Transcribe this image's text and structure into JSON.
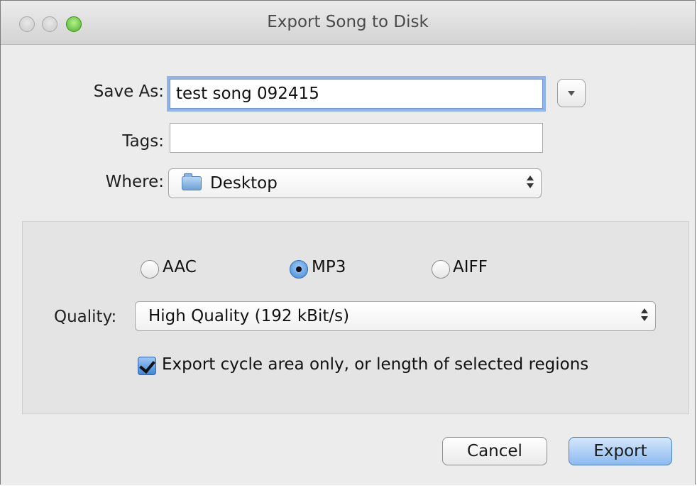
{
  "window": {
    "title": "Export Song to Disk"
  },
  "form": {
    "save_as_label": "Save As:",
    "save_as_value": "test song 092415",
    "tags_label": "Tags:",
    "tags_value": "",
    "where_label": "Where:",
    "where_value": "Desktop"
  },
  "format": {
    "options": [
      {
        "label": "AAC",
        "selected": false
      },
      {
        "label": "MP3",
        "selected": true
      },
      {
        "label": "AIFF",
        "selected": false
      }
    ],
    "quality_label": "Quality:",
    "quality_value": "High Quality (192 kBit/s)"
  },
  "cycle_option": {
    "label": "Export cycle area only, or length of selected regions",
    "checked": true
  },
  "buttons": {
    "cancel_label": "Cancel",
    "export_label": "Export"
  },
  "icons": {
    "close": "close-button-icon",
    "minimize": "minimize-button-icon",
    "zoom": "zoom-button-icon",
    "folder": "folder-icon",
    "dropdown": "chevron-down-icon",
    "updown": "updown-arrows-icon",
    "checkmark": "checkmark-icon"
  },
  "colors": {
    "accent": "#3e86d9",
    "window_bg": "#ececec",
    "focus_ring": "#8fb4ea"
  }
}
